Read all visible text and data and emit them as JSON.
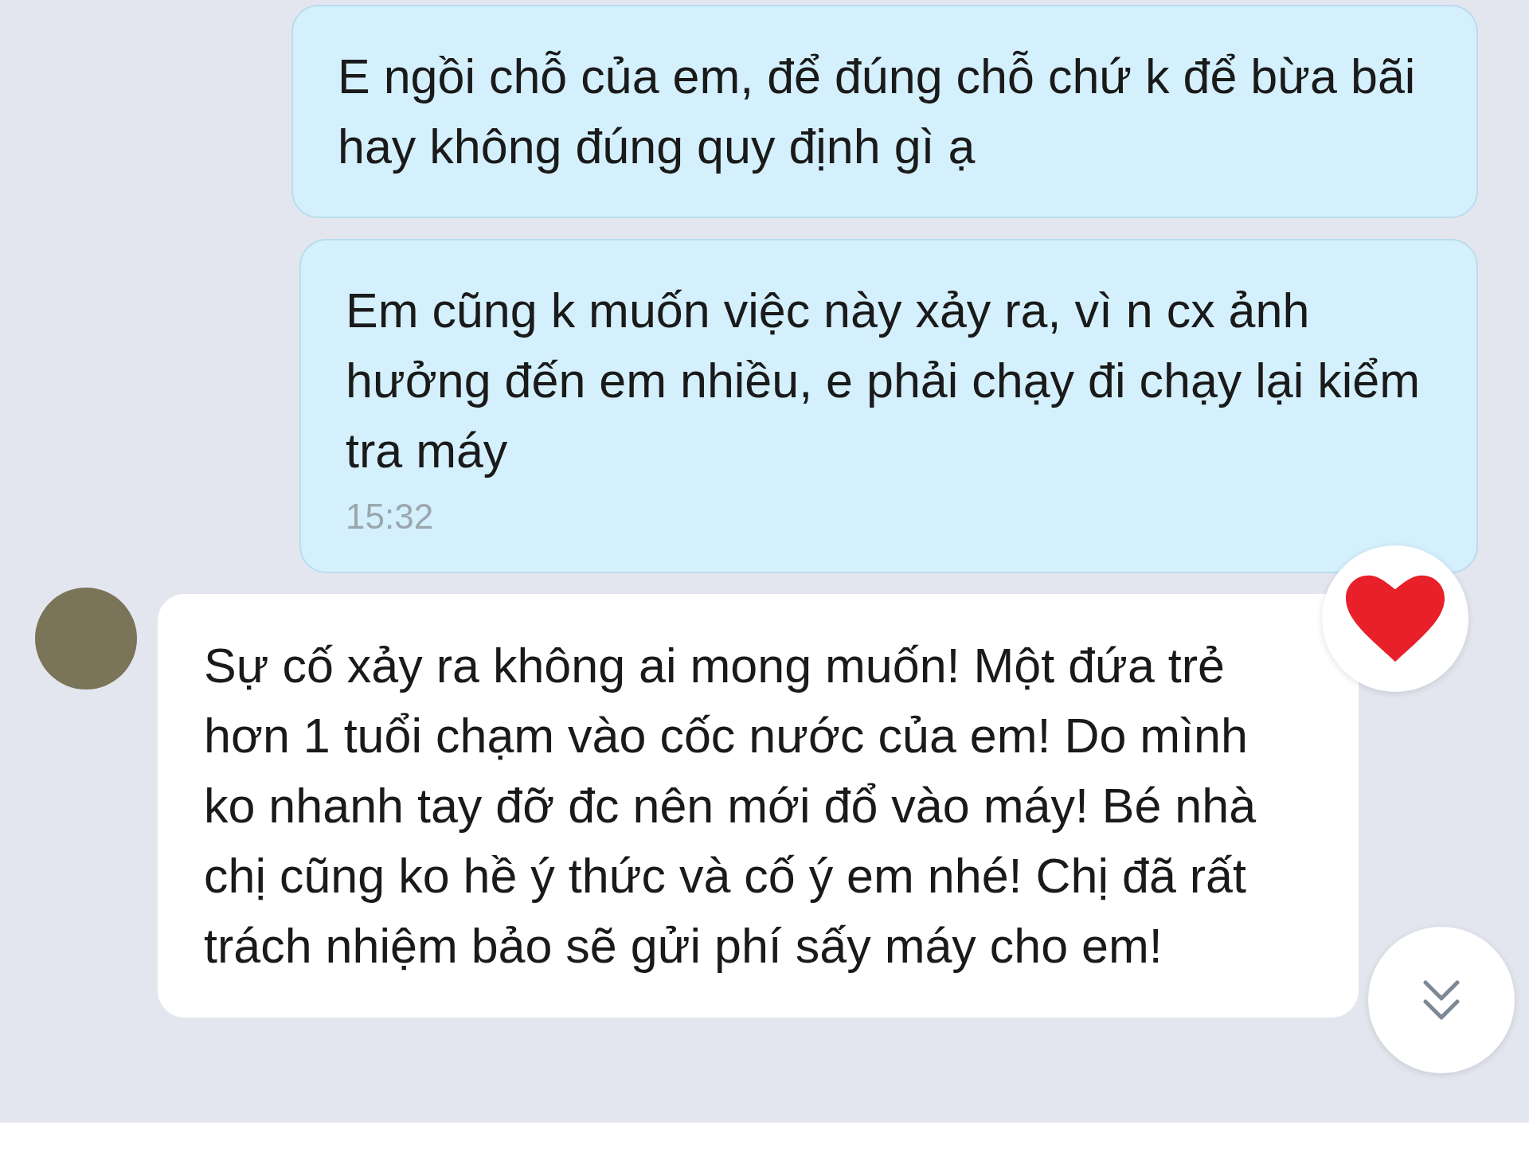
{
  "messages": [
    {
      "kind": "sent",
      "text": "E ngồi chỗ của em, để đúng chỗ chứ k để bừa bãi hay không đúng quy định gì ạ"
    },
    {
      "kind": "sent",
      "text": "Em cũng k muốn việc này xảy ra, vì n cx ảnh hưởng đến em nhiều, e phải chạy đi chạy lại kiểm tra máy",
      "time": "15:32",
      "reacted": true
    },
    {
      "kind": "received",
      "text": "Sự cố xảy ra không ai mong muốn! Một đứa trẻ hơn 1 tuổi chạm vào cốc nước của em! Do mình ko nhanh tay đỡ đc nên mới đổ vào máy! Bé nhà chị cũng ko hề ý thức và cố ý em nhé! Chị đã rất trách nhiệm bảo sẽ gửi phí sấy máy cho em!"
    }
  ]
}
